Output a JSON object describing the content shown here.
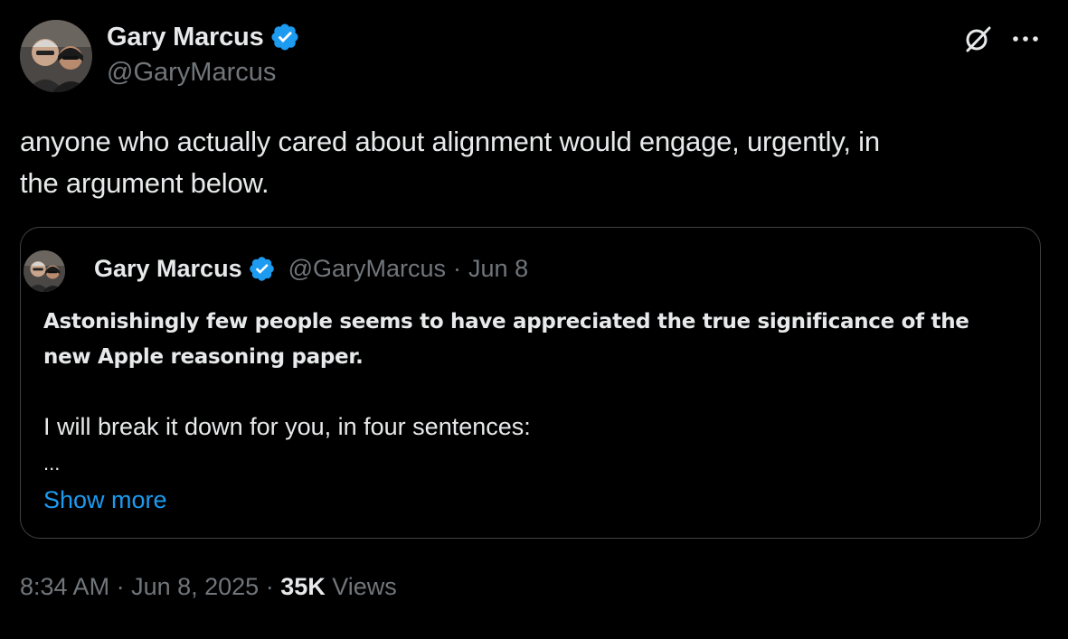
{
  "author": {
    "name": "Gary Marcus",
    "handle": "@GaryMarcus",
    "verified": true,
    "avatar_icon": "profile-photo-two-people"
  },
  "actions": {
    "grok_icon": "grok-icon",
    "more_icon": "more-horizontal-icon"
  },
  "tweet": {
    "text_line1": "anyone who actually cared about alignment would engage, urgently, in",
    "text_line2": "the argument below."
  },
  "quote": {
    "name": "Gary Marcus",
    "handle": "@GaryMarcus",
    "separator": "·",
    "date": "Jun 8",
    "bold_line1": "Astonishingly few people seems to have appreciated the true significance of the",
    "bold_line2": "new Apple reasoning paper.",
    "line": "I will break it down for you, in four sentences:",
    "ellipsis": "...",
    "show_more": "Show more"
  },
  "meta": {
    "time": "8:34 AM",
    "sep1": " · ",
    "date": "Jun 8, 2025",
    "sep2": " · ",
    "views_count": "35K",
    "views_label": "Views"
  },
  "colors": {
    "background": "#000000",
    "text": "#e7e9ea",
    "secondary": "#71767b",
    "link": "#1d9bf0",
    "verified": "#1d9bf0",
    "border": "#3e4144"
  }
}
